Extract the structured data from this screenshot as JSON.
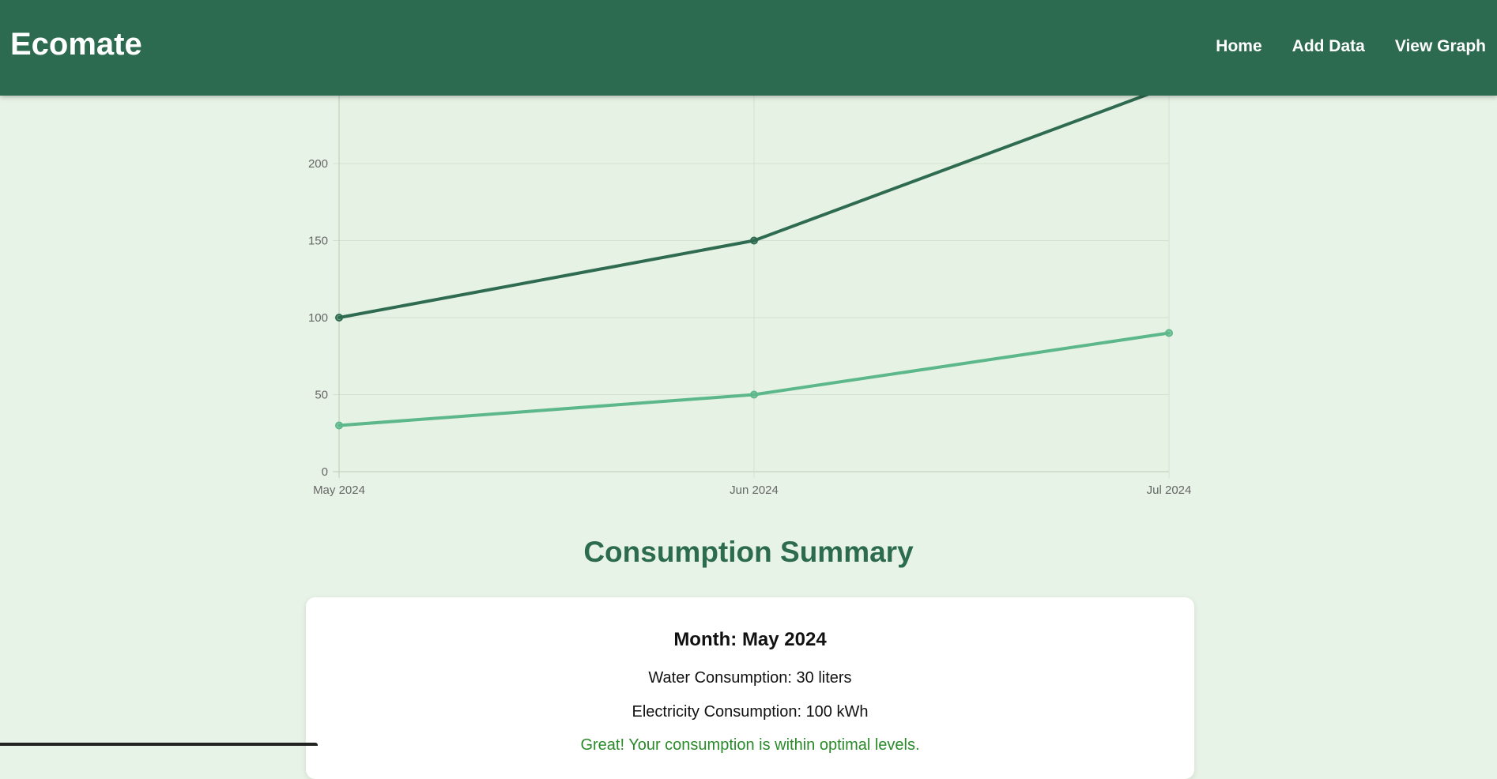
{
  "header": {
    "brand": "Ecomate",
    "nav": [
      {
        "label": "Home"
      },
      {
        "label": "Add Data"
      },
      {
        "label": "View Graph"
      }
    ]
  },
  "chart_data": {
    "type": "line",
    "categories": [
      "May 2024",
      "Jun 2024",
      "Jul 2024"
    ],
    "y_ticks": [
      0,
      50,
      100,
      150,
      200
    ],
    "ylim": [
      0,
      250
    ],
    "grid": true,
    "series": [
      {
        "values": [
          100,
          150,
          250
        ],
        "color": "#2e6b50"
      },
      {
        "values": [
          30,
          50,
          90
        ],
        "color": "#5cb88a"
      }
    ]
  },
  "summary": {
    "title": "Consumption Summary",
    "month_label": "Month: May 2024",
    "water": "Water Consumption: 30 liters",
    "electricity": "Electricity Consumption: 100 kWh",
    "message": "Great! Your consumption is within optimal levels."
  }
}
